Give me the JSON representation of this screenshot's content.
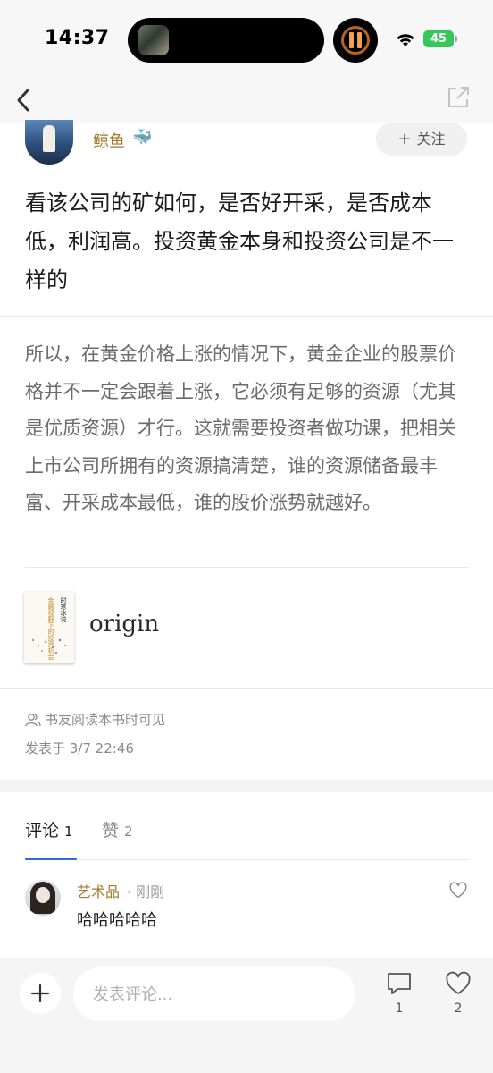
{
  "status_bar": {
    "time": "14:37",
    "battery": "45"
  },
  "author": {
    "name": "鲸鱼",
    "badge_emoji": "🐳",
    "follow_label": "关注"
  },
  "post": {
    "text": "看该公司的矿如何，是否好开采，是否成本低，利润高。投资黄金本身和投资公司是不一样的",
    "quote": "所以，在黄金价格上涨的情况下，黄金企业的股票价格并不一定会跟着上涨，它必须有足够的资源（尤其是优质资源）才行。这就需要投资者做功课，把相关上市公司所拥有的资源搞清楚，谁的资源储备最丰富、开采成本最低，谁的股价涨势就越好。"
  },
  "book": {
    "title": "origin",
    "cover_title_1": "时寒冰说",
    "cover_title_2": "金融视野下的投资机会"
  },
  "meta": {
    "visibility": "书友阅读本书时可见",
    "published": "发表于 3/7 22:46"
  },
  "tabs": {
    "comments_label": "评论",
    "comments_count": "1",
    "likes_label": "赞",
    "likes_count": "2"
  },
  "replies": [
    {
      "name": "艺术品",
      "time_sep": "· 刚刚",
      "text": "哈哈哈哈哈"
    }
  ],
  "bottom_bar": {
    "input_placeholder": "发表评论...",
    "comment_count": "1",
    "like_count": "2"
  },
  "colors": {
    "accent_author": "#a57a2e",
    "tab_underline": "#2f6bd8",
    "battery": "#35c759"
  }
}
